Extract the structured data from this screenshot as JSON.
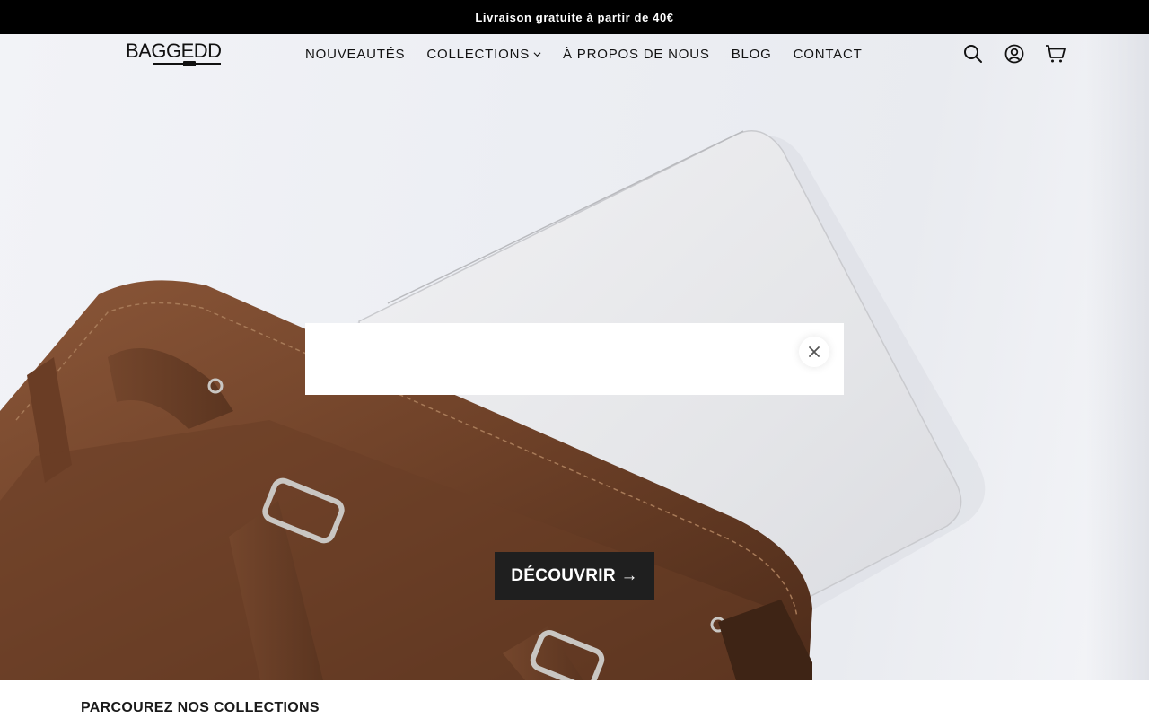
{
  "announcement": {
    "text": "Livraison gratuite à partir de 40€"
  },
  "logo": {
    "text": "BAGGEDD"
  },
  "nav": {
    "items": [
      {
        "label": "NOUVEAUTÉS"
      },
      {
        "label": "COLLECTIONS",
        "has_dropdown": true
      },
      {
        "label": "À PROPOS DE NOUS"
      },
      {
        "label": "BLOG"
      },
      {
        "label": "CONTACT"
      }
    ]
  },
  "header_icons": [
    "search-icon",
    "account-icon",
    "cart-icon"
  ],
  "hero": {
    "cta_label": "DÉCOUVRIR →",
    "image": "brown-leather-bag-with-laptop"
  },
  "modal": {
    "close_icon": "close-icon"
  },
  "collections": {
    "heading": "PARCOUREZ NOS COLLECTIONS"
  },
  "colors": {
    "announcement_bg": "#000000",
    "cta_bg": "#1f1f1f",
    "leather": "#7a4a2e"
  }
}
